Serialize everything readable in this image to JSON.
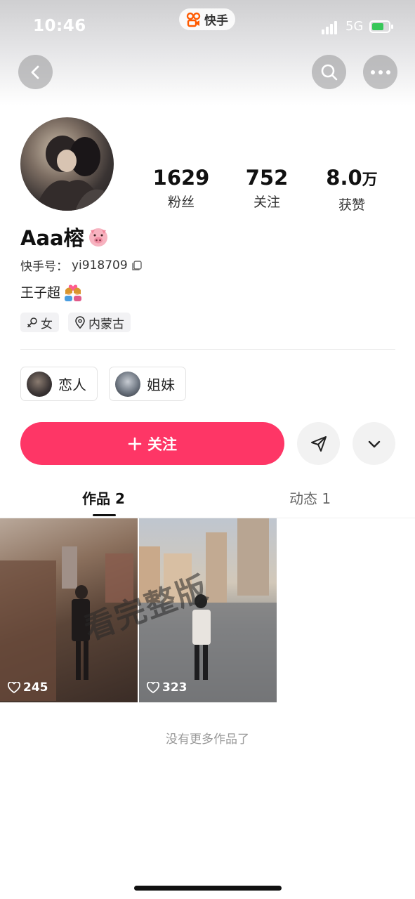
{
  "status_bar": {
    "time": "10:46",
    "network": "5G"
  },
  "app": {
    "name": "快手"
  },
  "profile": {
    "username": "Aaa榕",
    "kuaishou_id_label": "快手号：",
    "kuaishou_id": "yi918709",
    "bio": "王子超",
    "tags": [
      {
        "icon": "female-icon",
        "label": "女"
      },
      {
        "icon": "location-pin-icon",
        "label": "内蒙古"
      }
    ]
  },
  "stats": [
    {
      "value": "1629",
      "label": "粉丝"
    },
    {
      "value": "752",
      "label": "关注"
    },
    {
      "value": "8.0",
      "unit": "万",
      "label": "获赞"
    }
  ],
  "relations": [
    {
      "label": "恋人"
    },
    {
      "label": "姐妹"
    }
  ],
  "actions": {
    "follow_label": "关注"
  },
  "tabs": [
    {
      "label": "作品 2",
      "active": true
    },
    {
      "label": "动态 1",
      "active": false
    }
  ],
  "works": [
    {
      "likes": "245"
    },
    {
      "likes": "323"
    }
  ],
  "watermark": "看完整版",
  "footer": {
    "no_more": "没有更多作品了"
  },
  "colors": {
    "accent": "#fe3666",
    "tag_bg": "#f2f2f4"
  }
}
